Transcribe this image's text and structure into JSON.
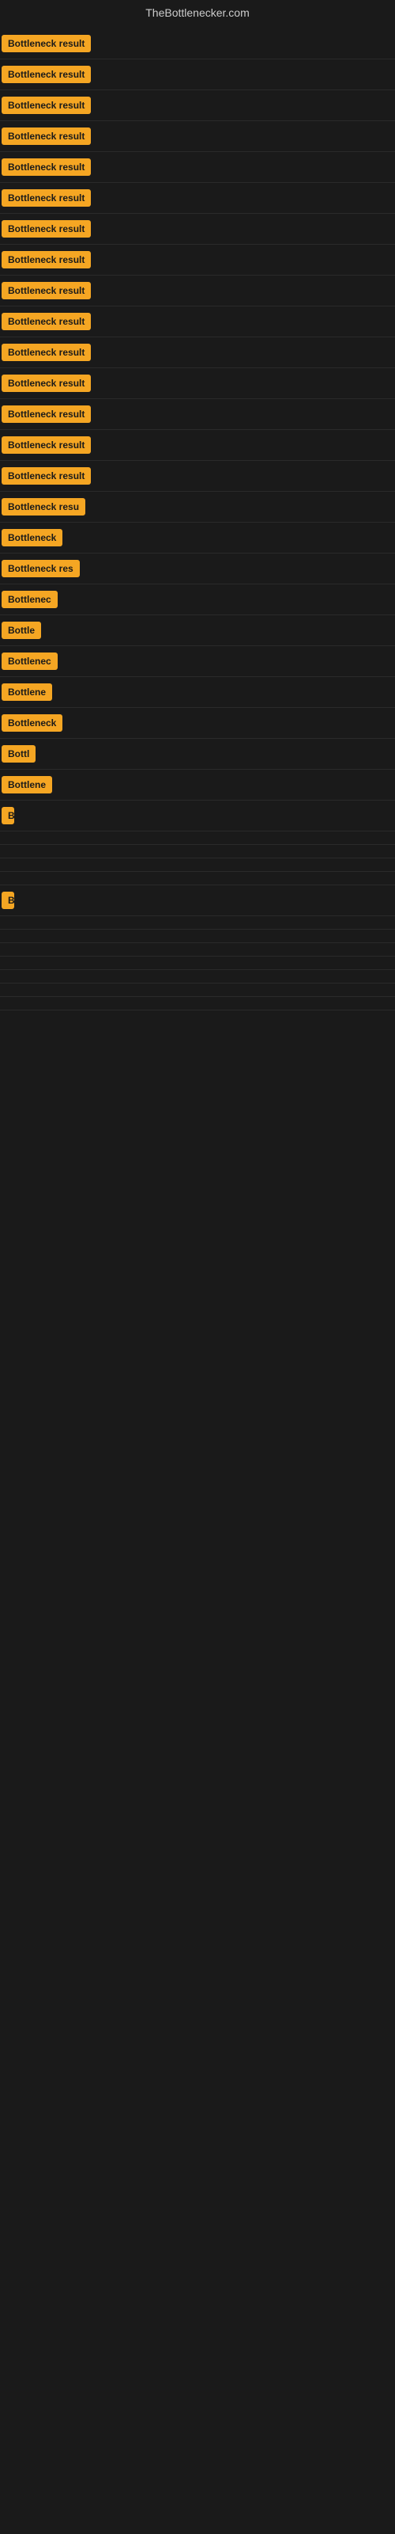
{
  "header": {
    "title": "TheBottlenecker.com"
  },
  "rows": [
    {
      "label": "Bottleneck result",
      "width": 120
    },
    {
      "label": "Bottleneck result",
      "width": 120
    },
    {
      "label": "Bottleneck result",
      "width": 120
    },
    {
      "label": "Bottleneck result",
      "width": 120
    },
    {
      "label": "Bottleneck result",
      "width": 120
    },
    {
      "label": "Bottleneck result",
      "width": 120
    },
    {
      "label": "Bottleneck result",
      "width": 120
    },
    {
      "label": "Bottleneck result",
      "width": 120
    },
    {
      "label": "Bottleneck result",
      "width": 120
    },
    {
      "label": "Bottleneck result",
      "width": 120
    },
    {
      "label": "Bottleneck result",
      "width": 120
    },
    {
      "label": "Bottleneck result",
      "width": 120
    },
    {
      "label": "Bottleneck result",
      "width": 120
    },
    {
      "label": "Bottleneck result",
      "width": 120
    },
    {
      "label": "Bottleneck result",
      "width": 120
    },
    {
      "label": "Bottleneck resu",
      "width": 110
    },
    {
      "label": "Bottleneck",
      "width": 80
    },
    {
      "label": "Bottleneck res",
      "width": 100
    },
    {
      "label": "Bottlenec",
      "width": 72
    },
    {
      "label": "Bottle",
      "width": 50
    },
    {
      "label": "Bottlenec",
      "width": 72
    },
    {
      "label": "Bottlene",
      "width": 64
    },
    {
      "label": "Bottleneck",
      "width": 80
    },
    {
      "label": "Bottl",
      "width": 44
    },
    {
      "label": "Bottlene",
      "width": 64
    },
    {
      "label": "B",
      "width": 14
    },
    {
      "label": "",
      "width": 0
    },
    {
      "label": "",
      "width": 0
    },
    {
      "label": "",
      "width": 0
    },
    {
      "label": "",
      "width": 0
    },
    {
      "label": "B",
      "width": 14
    },
    {
      "label": "",
      "width": 0
    },
    {
      "label": "",
      "width": 0
    },
    {
      "label": "",
      "width": 0
    },
    {
      "label": "",
      "width": 0
    },
    {
      "label": "",
      "width": 0
    },
    {
      "label": "",
      "width": 0
    },
    {
      "label": "",
      "width": 0
    }
  ],
  "colors": {
    "badge_bg": "#f5a623",
    "badge_text": "#1a1a1a",
    "background": "#1a1a1a",
    "header_text": "#cccccc"
  }
}
